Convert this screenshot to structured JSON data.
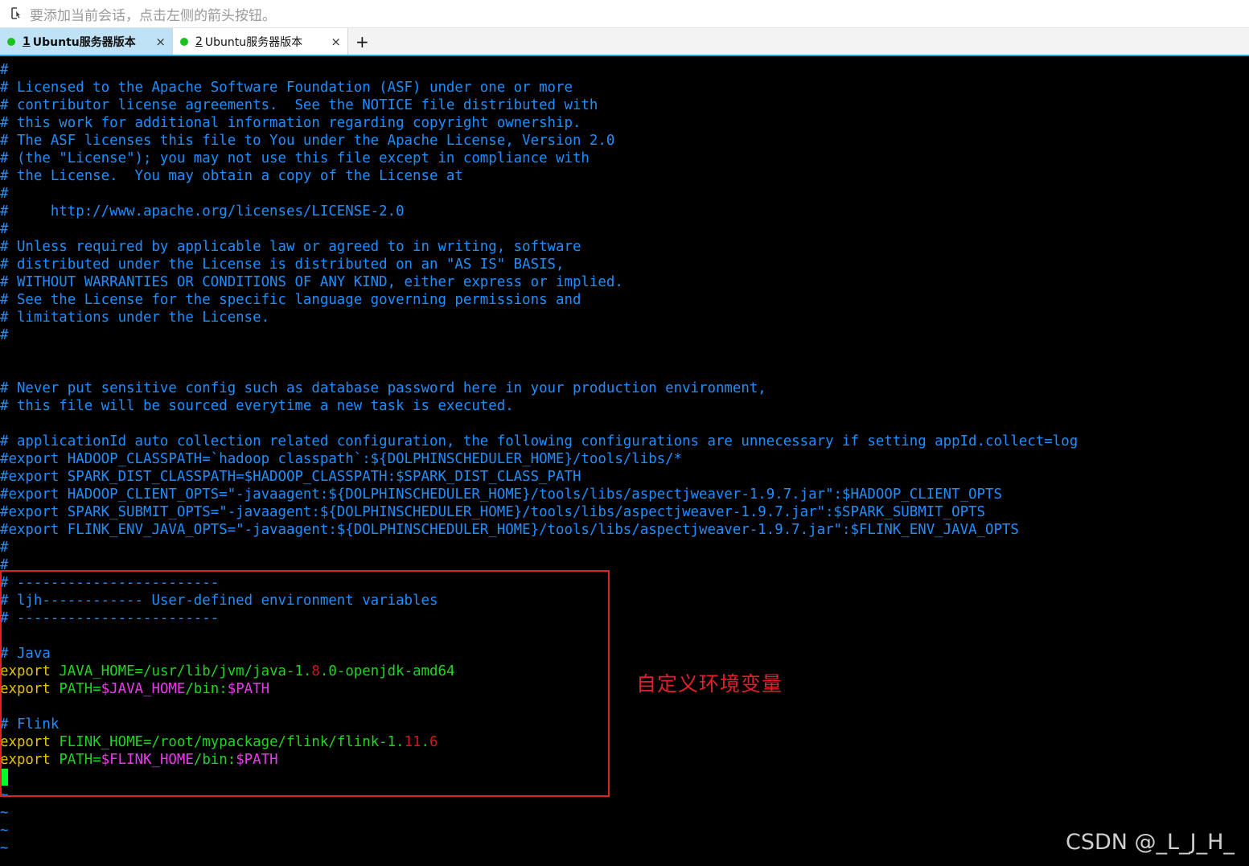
{
  "topbar": {
    "hint": "要添加当前会话，点击左侧的箭头按钮。"
  },
  "tabs": [
    {
      "index": "1",
      "title": "Ubuntu服务器版本",
      "close": "×",
      "active": true
    },
    {
      "index": "2",
      "title": "Ubuntu服务器版本",
      "close": "×",
      "active": false
    }
  ],
  "tab_add": "+",
  "terminal": {
    "lines": [
      "#",
      "# Licensed to the Apache Software Foundation (ASF) under one or more",
      "# contributor license agreements.  See the NOTICE file distributed with",
      "# this work for additional information regarding copyright ownership.",
      "# The ASF licenses this file to You under the Apache License, Version 2.0",
      "# (the \"License\"); you may not use this file except in compliance with",
      "# the License.  You may obtain a copy of the License at",
      "#",
      "#     http://www.apache.org/licenses/LICENSE-2.0",
      "#",
      "# Unless required by applicable law or agreed to in writing, software",
      "# distributed under the License is distributed on an \"AS IS\" BASIS,",
      "# WITHOUT WARRANTIES OR CONDITIONS OF ANY KIND, either express or implied.",
      "# See the License for the specific language governing permissions and",
      "# limitations under the License.",
      "#",
      "",
      "",
      "# Never put sensitive config such as database password here in your production environment,",
      "# this file will be sourced everytime a new task is executed.",
      "",
      "# applicationId auto collection related configuration, the following configurations are unnecessary if setting appId.collect=log",
      "#export HADOOP_CLASSPATH=`hadoop classpath`:${DOLPHINSCHEDULER_HOME}/tools/libs/*",
      "#export SPARK_DIST_CLASSPATH=$HADOOP_CLASSPATH:$SPARK_DIST_CLASS_PATH",
      "#export HADOOP_CLIENT_OPTS=\"-javaagent:${DOLPHINSCHEDULER_HOME}/tools/libs/aspectjweaver-1.9.7.jar\":$HADOOP_CLIENT_OPTS",
      "#export SPARK_SUBMIT_OPTS=\"-javaagent:${DOLPHINSCHEDULER_HOME}/tools/libs/aspectjweaver-1.9.7.jar\":$SPARK_SUBMIT_OPTS",
      "#export FLINK_ENV_JAVA_OPTS=\"-javaagent:${DOLPHINSCHEDULER_HOME}/tools/libs/aspectjweaver-1.9.7.jar\":$FLINK_ENV_JAVA_OPTS",
      "#",
      "#",
      "# ------------------------",
      "# ljh------------ User-defined environment variables",
      "# ------------------------",
      "",
      "# Java"
    ],
    "java_home": {
      "kw": "export",
      "name": "JAVA_HOME=/usr/lib/jvm/java-1.",
      "num": "8",
      "rest": ".0-openjdk-amd64"
    },
    "java_path": {
      "kw": "export",
      "name": "PATH=",
      "ref1": "$JAVA_HOME",
      "mid": "/bin:",
      "ref2": "$PATH"
    },
    "flink_comment": "# Flink",
    "flink_home": {
      "kw": "export",
      "name": "FLINK_HOME=/root/mypackage/flink/flink-1.",
      "num1": "11",
      "dot": ".",
      "num2": "6"
    },
    "flink_path": {
      "kw": "export",
      "name": "PATH=",
      "ref1": "$FLINK_HOME",
      "mid": "/bin:",
      "ref2": "$PATH"
    },
    "tildes": [
      "~",
      "~",
      "~",
      "~"
    ]
  },
  "annotation": "自定义环境变量",
  "watermark": "CSDN @_L_J_H_",
  "colors": {
    "comment": "#1f8fff",
    "keyword": "#e6c300",
    "variable": "#1fd51f",
    "number": "#c81a1a",
    "reference": "#ee38ee",
    "cursor": "#00ff22",
    "highlight": "#e0202a",
    "tab_active": "#bfe2f6"
  }
}
